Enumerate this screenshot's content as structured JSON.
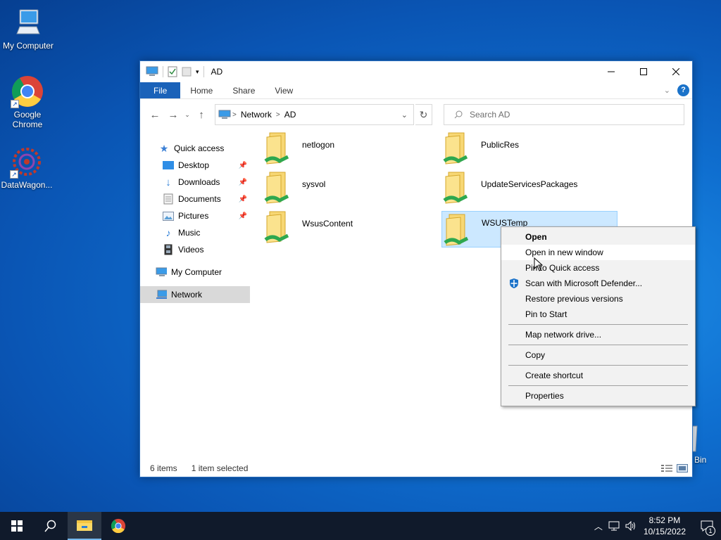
{
  "desktop": {
    "icons": [
      {
        "label": "My Computer"
      },
      {
        "label": "Google Chrome"
      },
      {
        "label": "DataWagon..."
      }
    ],
    "recycle_bin_label": "Bin"
  },
  "window": {
    "title": "AD",
    "ribbon_tabs": [
      "File",
      "Home",
      "Share",
      "View"
    ],
    "help_label": "?",
    "breadcrumb": [
      "Network",
      "AD"
    ],
    "search_placeholder": "Search AD",
    "nav_pane": {
      "quick_access": "Quick access",
      "quick_items": [
        "Desktop",
        "Downloads",
        "Documents",
        "Pictures",
        "Music",
        "Videos"
      ],
      "my_computer": "My Computer",
      "network": "Network"
    },
    "items": [
      {
        "name": "netlogon",
        "selected": false
      },
      {
        "name": "PublicRes",
        "selected": false
      },
      {
        "name": "sysvol",
        "selected": false
      },
      {
        "name": "UpdateServicesPackages",
        "selected": false
      },
      {
        "name": "WsusContent",
        "selected": false
      },
      {
        "name": "WSUSTemp",
        "selected": true
      }
    ],
    "status": {
      "item_count": "6 items",
      "selection": "1 item selected"
    }
  },
  "context_menu": {
    "items": [
      {
        "label": "Open",
        "bold": true
      },
      {
        "label": "Open in new window",
        "hover": true
      },
      {
        "label": "Pin to Quick access"
      },
      {
        "label": "Scan with Microsoft Defender...",
        "icon": "defender-icon"
      },
      {
        "label": "Restore previous versions"
      },
      {
        "label": "Pin to Start"
      },
      {
        "label": "Map network drive..."
      },
      {
        "label": "Copy"
      },
      {
        "label": "Create shortcut"
      },
      {
        "label": "Properties"
      }
    ]
  },
  "taskbar": {
    "time": "8:52 PM",
    "date": "10/15/2022",
    "notification_count": "1"
  },
  "colors": {
    "accent": "#1a62b9",
    "selection_bg": "#cce8ff",
    "taskbar_bg": "#101a2b"
  }
}
